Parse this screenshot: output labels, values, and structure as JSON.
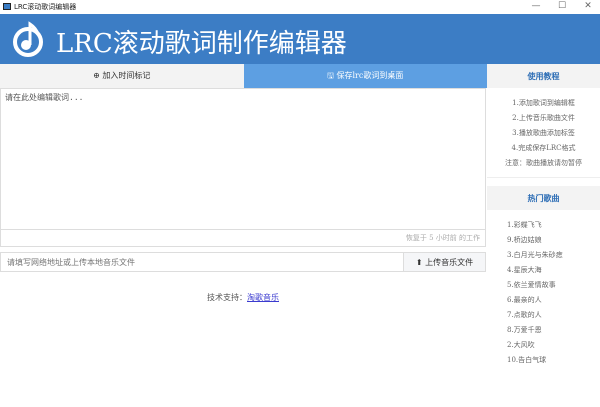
{
  "window": {
    "title": "LRC滚动歌词编辑器",
    "minimize": "—",
    "maximize": "☐",
    "close": "✕"
  },
  "header": {
    "title": "LRC滚动歌词制作编辑器",
    "logo": "music-note-icon",
    "color": "#3c7dc5"
  },
  "tabs": [
    {
      "label": "加入时间标记",
      "icon": "plus-circle-icon"
    },
    {
      "label": "保存lrc歌词到桌面",
      "icon": "floppy-disk-icon"
    }
  ],
  "editor": {
    "placeholder": "请在此处编辑歌词..."
  },
  "status": "恢复于 5 小时前 的工作",
  "url": {
    "placeholder": "请填写网络地址或上传本地音乐文件",
    "upload_label": "上传音乐文件"
  },
  "support": {
    "label": "技术支持：",
    "link": "淘歌音乐"
  },
  "sidebar": {
    "guide_title": "使用教程",
    "guide": [
      "1.添加歌词到编辑框",
      "2.上传音乐歌曲文件",
      "3.播放歌曲添加标签",
      "4.完成保存LRC格式",
      "注意：歌曲播放请勿暂停"
    ],
    "hot_title": "热门歌曲",
    "songs": [
      "1.彩蝶飞飞",
      "9.桥边姑娘",
      "3.白月光与朱砂痣",
      "4.星辰大海",
      "5.依兰爱情故事",
      "6.最亲的人",
      "7.点歌的人",
      "8.万爱千恩",
      "2.大风吹",
      "10.告白气球"
    ]
  }
}
